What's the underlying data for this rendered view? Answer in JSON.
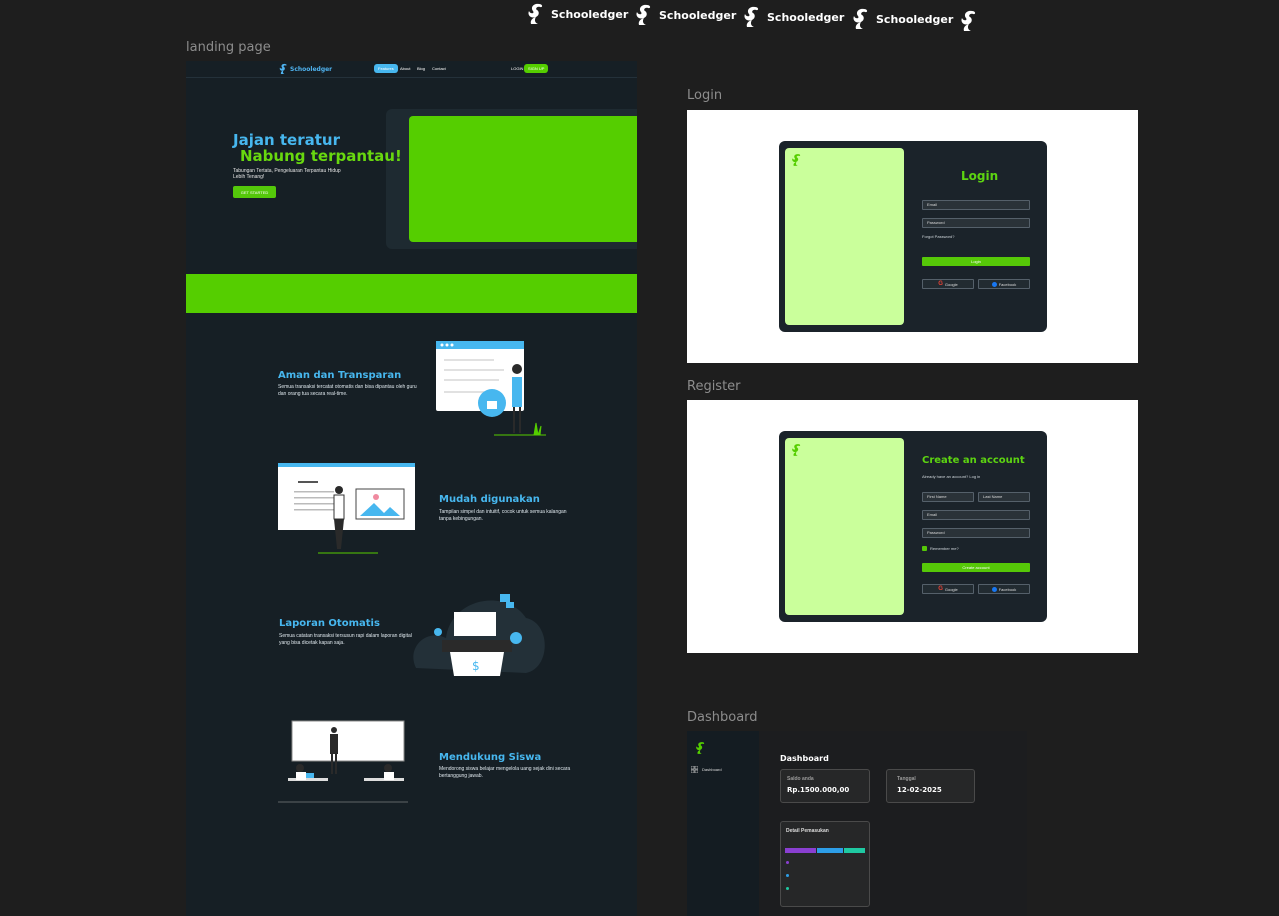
{
  "brand": {
    "name": "Schooledger",
    "repeat": [
      "Schooledger",
      "Schooledger",
      "Schooledger",
      "Schooledger"
    ]
  },
  "frames": {
    "landing": "landing page",
    "login": "Login",
    "register": "Register",
    "dashboard": "Dashboard"
  },
  "landing": {
    "nav": {
      "logo": "Schooledger",
      "links": [
        "Features",
        "About",
        "Blog",
        "Contact"
      ],
      "login": "LOGIN",
      "signup": "SIGN UP"
    },
    "hero": {
      "title_line1": "Jajan teratur",
      "title_line2": "Nabung terpantau!",
      "subtitle": "Tabungan Tertata, Pengeluaran Terpantau Hidup Lebih Tenang!",
      "cta": "GET STARTED"
    },
    "features": [
      {
        "title": "Aman dan Transparan",
        "desc": "Semua transaksi tercatat otomatis dan bisa dipantau oleh guru dan orang tua secara real-time."
      },
      {
        "title": "Mudah digunakan",
        "desc": "Tampilan simpel dan intuitif, cocok untuk semua kalangan tanpa kebingungan."
      },
      {
        "title": "Laporan Otomatis",
        "desc": "Semua catatan transaksi tersusun rapi dalam laporan digital yang bisa dicetak kapan saja."
      },
      {
        "title": "Mendukung Siswa",
        "desc": "Mendorong siswa belajar mengelola uang sejak dini secara bertanggung jawab."
      }
    ]
  },
  "login": {
    "title": "Login",
    "email_placeholder": "Email",
    "password_placeholder": "Password",
    "forgot": "Forgot Password?",
    "submit": "Login",
    "google": "Google",
    "facebook": "Facebook"
  },
  "register": {
    "title": "Create an account",
    "subtitle": "Already have an account? Log in",
    "first_name": "First Name",
    "last_name": "Last Name",
    "email": "Email",
    "password": "Password",
    "remember": "Remember me?",
    "submit": "Create account",
    "google": "Google",
    "facebook": "Facebook"
  },
  "dashboard": {
    "sidebar_item": "Dashboard",
    "heading": "Dashboard",
    "saldo_label": "Saldo anda",
    "saldo_value": "Rp.1500.000,00",
    "tanggal_label": "Tanggal",
    "tanggal_value": "12-02-2025",
    "detail_title": "Detail Pemasukan",
    "detail_bar": [
      0.4,
      0.33,
      0.27
    ],
    "colors": {
      "bar1": "#8a3fd1",
      "bar2": "#2d9ee8",
      "bar3": "#1fc9a2"
    }
  },
  "colors": {
    "accent_green": "#55ce00",
    "accent_blue": "#47b7ef",
    "bg": "#1e1e1e",
    "panel": "#161f25"
  }
}
